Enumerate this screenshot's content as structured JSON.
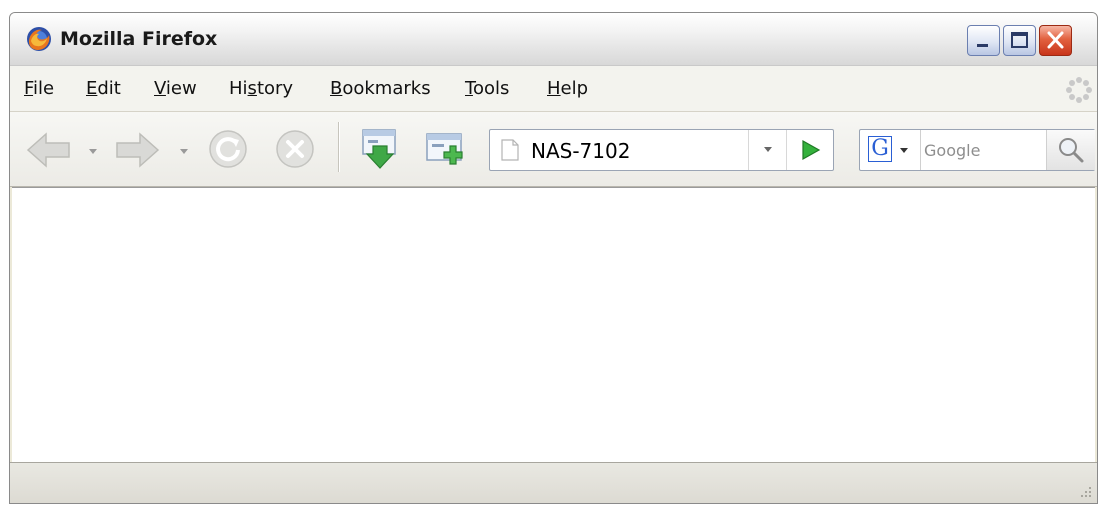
{
  "window": {
    "title": "Mozilla Firefox",
    "controls": {
      "minimize": "minimize-icon",
      "maximize": "maximize-icon",
      "close": "close-icon"
    }
  },
  "menu": [
    {
      "pre": "",
      "acc": "F",
      "post": "ile"
    },
    {
      "pre": "",
      "acc": "E",
      "post": "dit"
    },
    {
      "pre": "",
      "acc": "V",
      "post": "iew"
    },
    {
      "pre": "Hi",
      "acc": "s",
      "post": "tory"
    },
    {
      "pre": "",
      "acc": "B",
      "post": "ookmarks"
    },
    {
      "pre": "",
      "acc": "T",
      "post": "ools"
    },
    {
      "pre": "",
      "acc": "H",
      "post": "elp"
    }
  ],
  "toolbar": {
    "buttons": [
      "back-icon",
      "forward-icon",
      "reload-icon",
      "stop-icon",
      "download-page-icon",
      "new-window-icon"
    ],
    "address": {
      "value": "NAS-7102",
      "page_icon": "blank-page-icon"
    },
    "search": {
      "engine": "G",
      "placeholder": "Google",
      "go_icon": "magnifier-icon"
    }
  },
  "colors": {
    "accent_close": "#d4472a",
    "go_arrow": "#2fa83a",
    "google_blue": "#2a5fd4"
  }
}
